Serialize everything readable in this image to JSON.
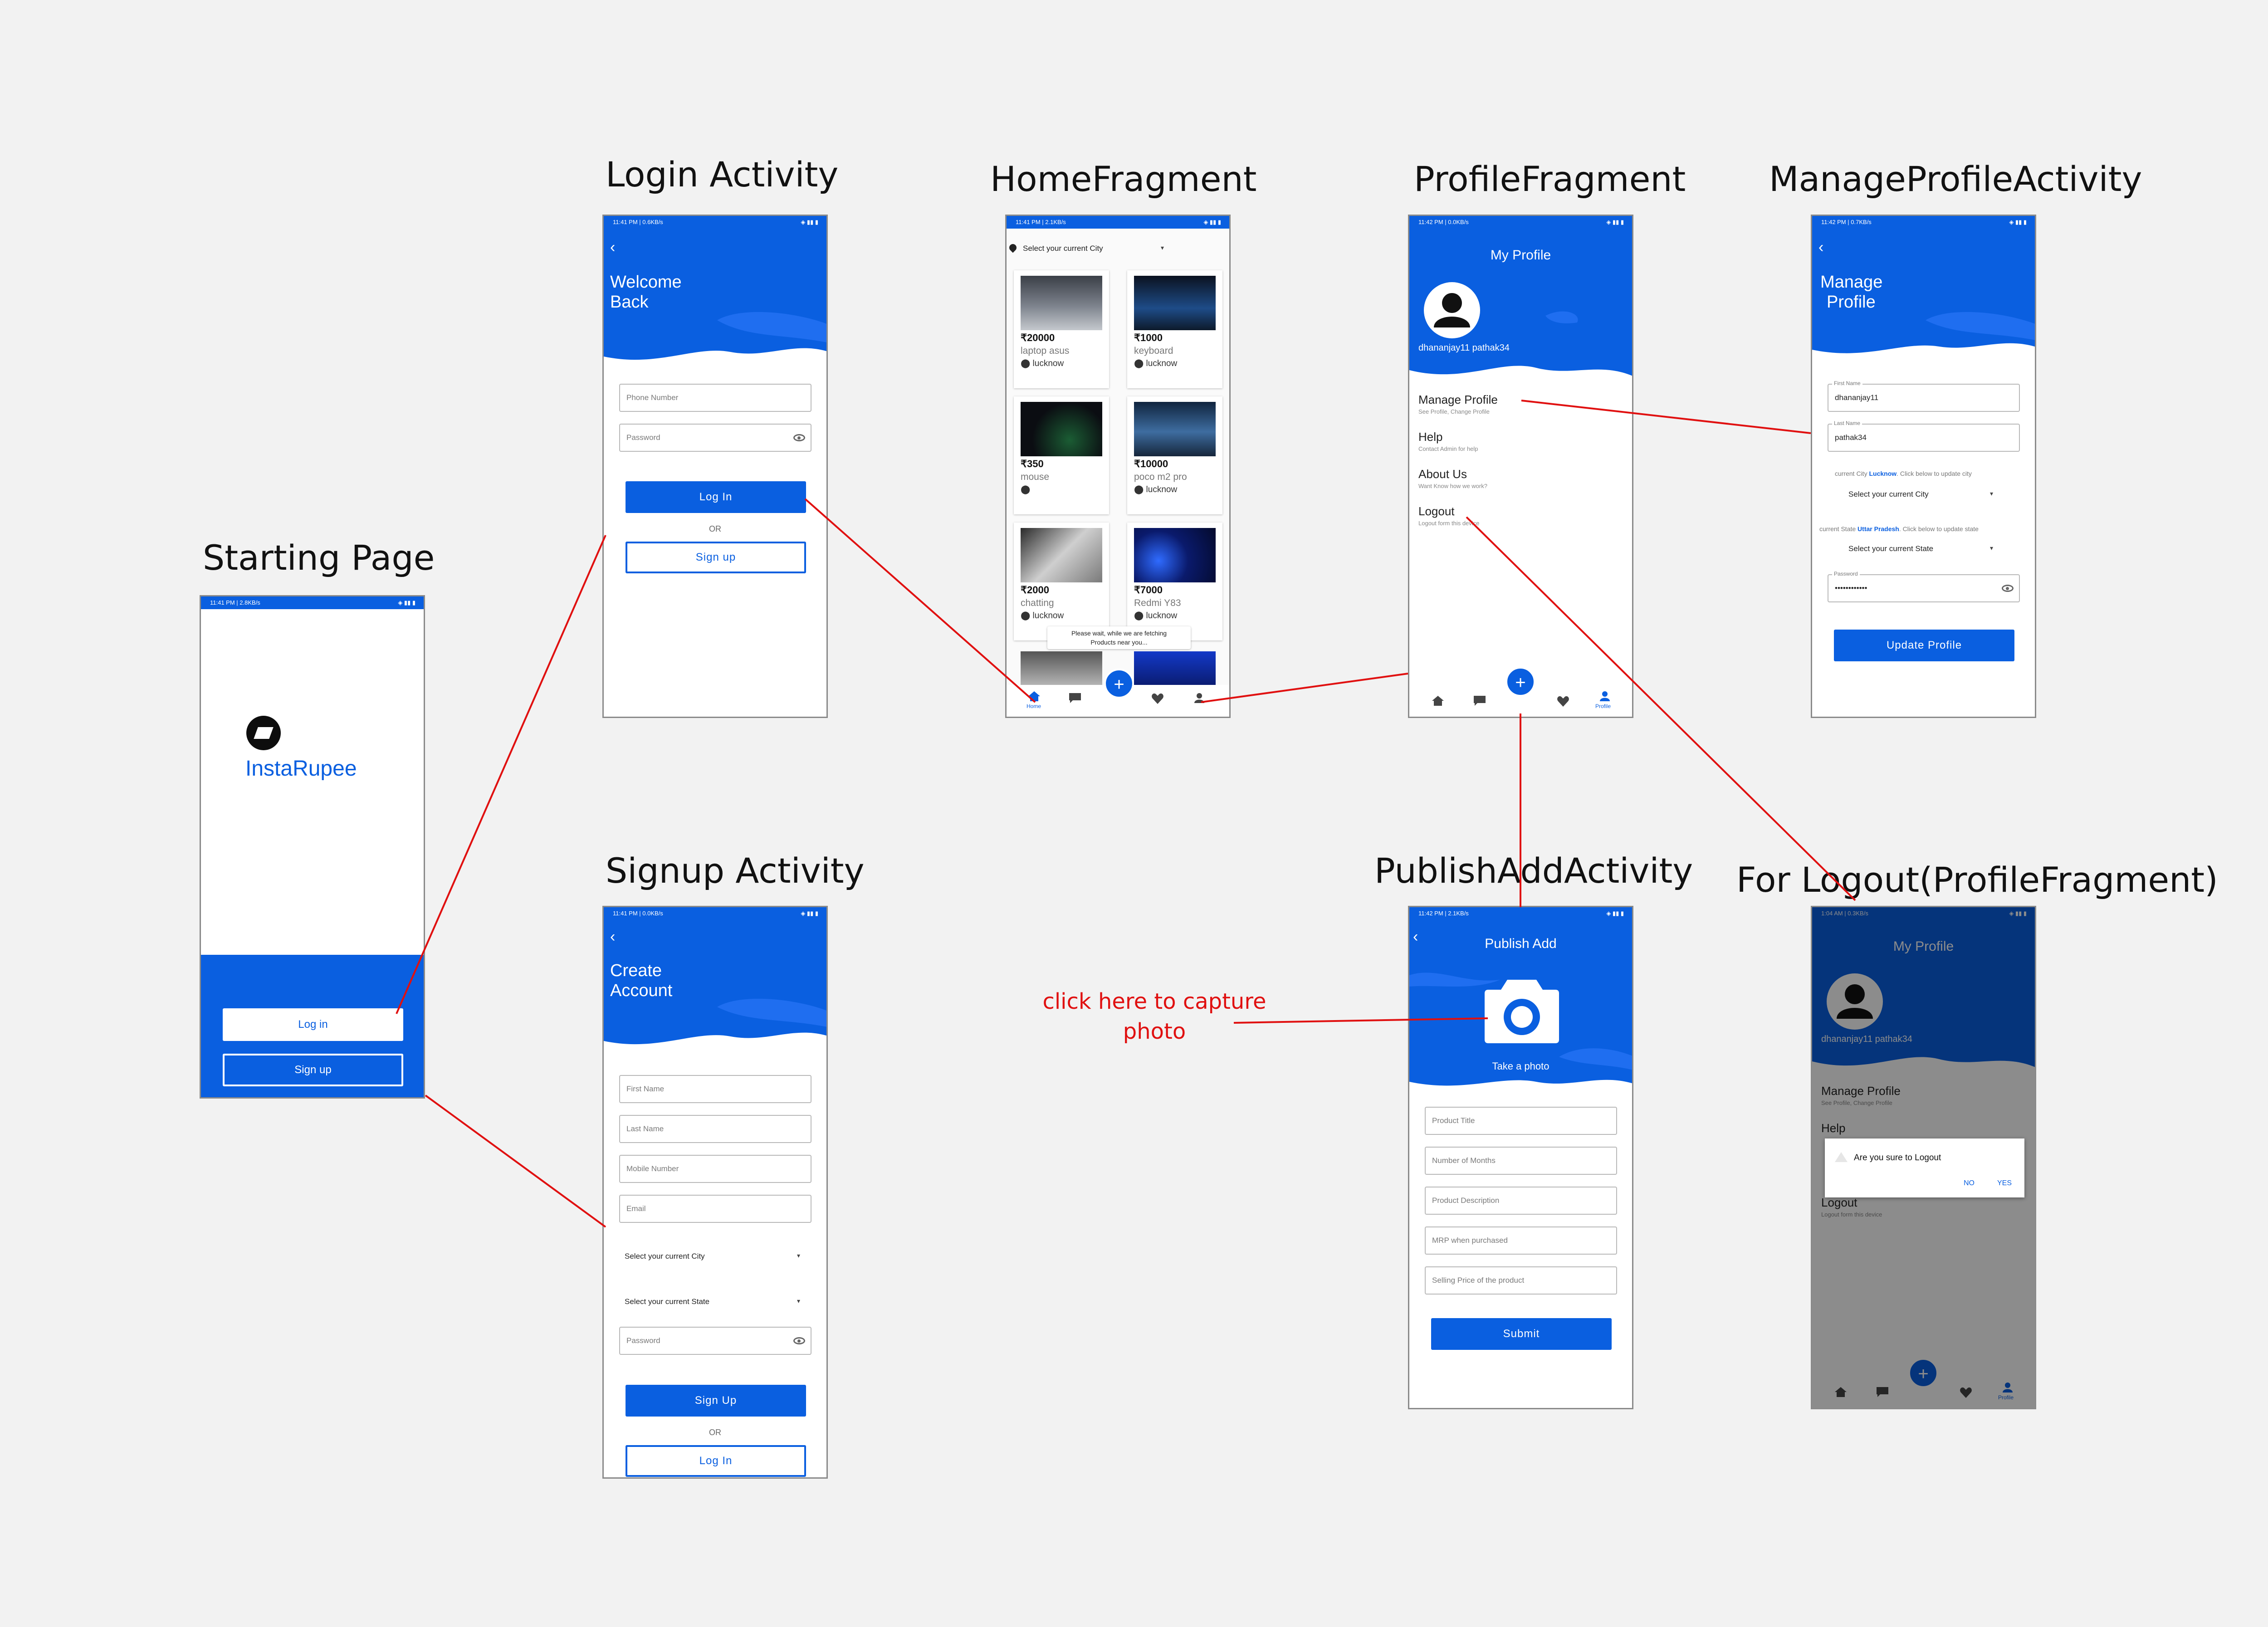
{
  "colors": {
    "primary": "#0a5fe0",
    "connector": "#e01010",
    "background": "#f2f2f2"
  },
  "labels": {
    "starting": "Starting Page",
    "login": "Login Activity",
    "signup": "Signup Activity",
    "home": "HomeFragment",
    "profile": "ProfileFragment",
    "manage": "ManageProfileActivity",
    "publish": "PublishAddActivity",
    "logout": "For Logout(ProfileFragment)"
  },
  "note": {
    "line1": "click here to capture",
    "line2": "photo"
  },
  "starting": {
    "status_left": "11:41 PM | 2.8KB/s",
    "app_name": "InstaRupee",
    "login_button": "Log in",
    "signup_button": "Sign up"
  },
  "login": {
    "status_left": "11:41 PM | 0.6KB/s",
    "title_line1": "Welcome",
    "title_line2": "Back",
    "phone_placeholder": "Phone Number",
    "password_placeholder": "Password",
    "login_button": "Log In",
    "or": "OR",
    "signup_button": "Sign up"
  },
  "signup": {
    "status_left": "11:41 PM | 0.0KB/s",
    "title_line1": "Create",
    "title_line2": "Account",
    "first_name": "First Name",
    "last_name": "Last Name",
    "mobile": "Mobile Number",
    "email": "Email",
    "city_select": "Select your current City",
    "state_select": "Select your current State",
    "password": "Password",
    "signup_button": "Sign Up",
    "or": "OR",
    "login_button": "Log In"
  },
  "home": {
    "status_left": "11:41 PM | 2.1KB/s",
    "city_select": "Select your current City",
    "products": [
      {
        "price": "₹20000",
        "name": "laptop asus",
        "location": "lucknow"
      },
      {
        "price": "₹1000",
        "name": "keyboard",
        "location": "lucknow"
      },
      {
        "price": "₹350",
        "name": "mouse",
        "location": ""
      },
      {
        "price": "₹10000",
        "name": "poco m2 pro",
        "location": "lucknow"
      },
      {
        "price": "₹2000",
        "name": "chatting",
        "location": "lucknow"
      },
      {
        "price": "₹7000",
        "name": "Redmi Y83",
        "location": "lucknow"
      }
    ],
    "toast_line1": "Please wait, while we are fetching",
    "toast_line2": "Products near you...",
    "nav_home": "Home"
  },
  "profile": {
    "status_left": "11:42 PM | 0.0KB/s",
    "title": "My Profile",
    "username": "dhananjay11 pathak34",
    "menu": [
      {
        "title": "Manage Profile",
        "subtitle": "See Profile, Change Profile"
      },
      {
        "title": "Help",
        "subtitle": "Contact Admin for help"
      },
      {
        "title": "About Us",
        "subtitle": "Want Know how we work?"
      },
      {
        "title": "Logout",
        "subtitle": "Logout form this device"
      }
    ],
    "nav_profile": "Profile"
  },
  "manage": {
    "status_left": "11:42 PM | 0.7KB/s",
    "title_line1": "Manage",
    "title_line2": "Profile",
    "first_name_label": "First Name",
    "first_name_value": "dhananjay11",
    "last_name_label": "Last Name",
    "last_name_value": "pathak34",
    "city_prefix": "current City",
    "city_value": "Lucknow",
    "city_suffix": ". Click below to update city",
    "city_select": "Select your current City",
    "state_prefix": "current State",
    "state_value": "Uttar Pradesh",
    "state_suffix": ". Click below to update state",
    "state_select": "Select your current State",
    "password_label": "Password",
    "password_value": "••••••••••••",
    "update_button": "Update Profile"
  },
  "publish": {
    "status_left": "11:42 PM | 2.1KB/s",
    "title": "Publish Add",
    "take_photo": "Take a photo",
    "fields": [
      "Product Title",
      "Number of Months",
      "Product Description",
      "MRP when purchased",
      "Selling Price of the product"
    ],
    "submit_button": "Submit"
  },
  "logout": {
    "status_left": "1:04 AM | 0.3KB/s",
    "title": "My Profile",
    "username": "dhananjay11 pathak34",
    "menu_manage": "Manage Profile",
    "menu_manage_sub": "See Profile, Change Profile",
    "menu_help": "Help",
    "menu_logout": "Logout",
    "menu_logout_sub": "Logout form this device",
    "dialog_text": "Are you sure to Logout",
    "dialog_no": "NO",
    "dialog_yes": "YES",
    "nav_profile": "Profile"
  }
}
